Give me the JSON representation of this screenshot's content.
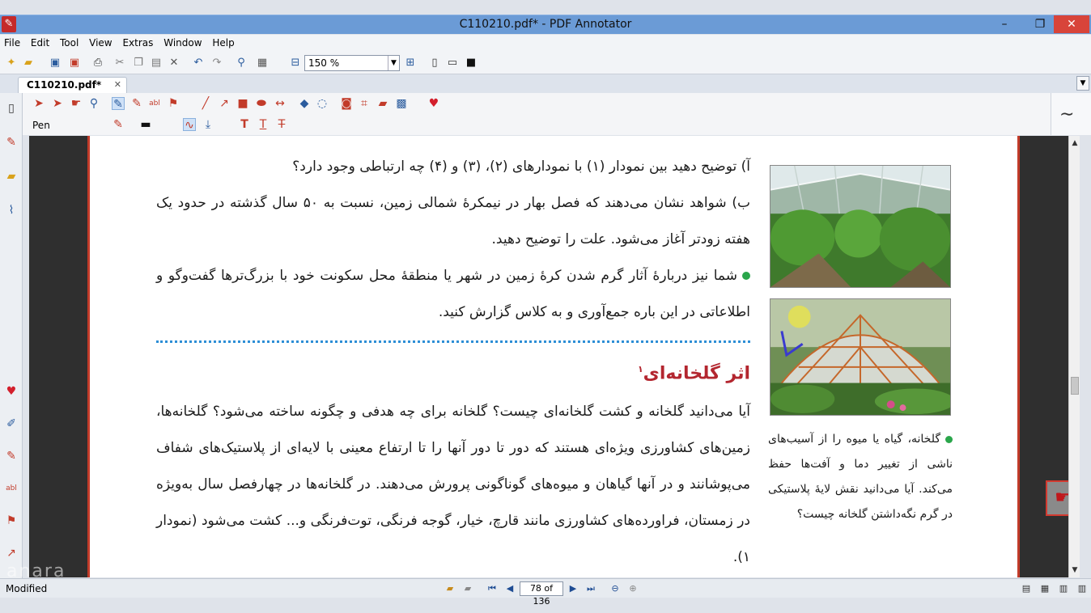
{
  "window": {
    "title": "C110210.pdf* - PDF Annotator",
    "app_icon": "pdf-annotator-logo"
  },
  "menu": [
    "File",
    "Edit",
    "Tool",
    "View",
    "Extras",
    "Window",
    "Help"
  ],
  "toolbar": {
    "zoom_value": "150 %"
  },
  "tabs": [
    {
      "label": "C110210.pdf*"
    }
  ],
  "annotation_toolbar": {
    "tool_label": "Pen"
  },
  "document": {
    "paragraphs": [
      "آ) توضیح دهید بین نمودار (۱) با نمودارهای (۲)، (۳) و (۴) چه ارتباطی وجود دارد؟",
      "ب) شواهد نشان می‌دهند که فصل بهار در نیمکرهٔ شمالی زمین، نسبت به ۵۰ سال گذشته در حدود یک هفته زودتر آغاز می‌شود. علت را توضیح دهید.",
      "شما نیز دربارهٔ آثار گرم شدن کرهٔ زمین در شهر یا منطقهٔ محل سکونت خود با بزرگ‌ترها گفت‌وگو و اطلاعاتی در این باره جمع‌آوری و به کلاس گزارش کنید."
    ],
    "heading": "اثر گلخانه‌ای",
    "heading_footnote": "۱",
    "body": "آیا می‌دانید گلخانه و کشت گلخانه‌ای چیست؟ گلخانه برای چه هدفی و چگونه ساخته می‌شود؟ گلخانه‌ها، زمین‌های کشاورزی ویژه‌ای هستند که دور تا دور آنها را تا ارتفاع معینی با لایه‌ای از پلاستیک‌های شفاف می‌پوشانند و در آنها گیاهان و میوه‌های گوناگونی پرورش می‌دهند. در گلخانه‌ها در چهارفصل سال به‌ویژه در زمستان، فراورده‌های کشاورزی مانند قارچ، خیار، گوجه فرنگی، توت‌فرنگی و... کشت می‌شود (نمودار ۱).",
    "caption": "گلخانه، گیاه یا میوه را از آسیب‌های ناشی از تغییر دما و آفت‌ها حفظ می‌کند. آیا می‌دانید نقش لایهٔ پلاستیکی در گرم نگه‌داشتن گلخانه چیست؟"
  },
  "status": {
    "state": "Modified",
    "page_display": "78 of 136"
  },
  "watermark": "anara",
  "colors": {
    "titlebar": "#6b9bd6",
    "page_border": "#c23b2a",
    "heading": "#b3262f",
    "bullet": "#2aa64b",
    "divider": "#2d8ed6"
  }
}
